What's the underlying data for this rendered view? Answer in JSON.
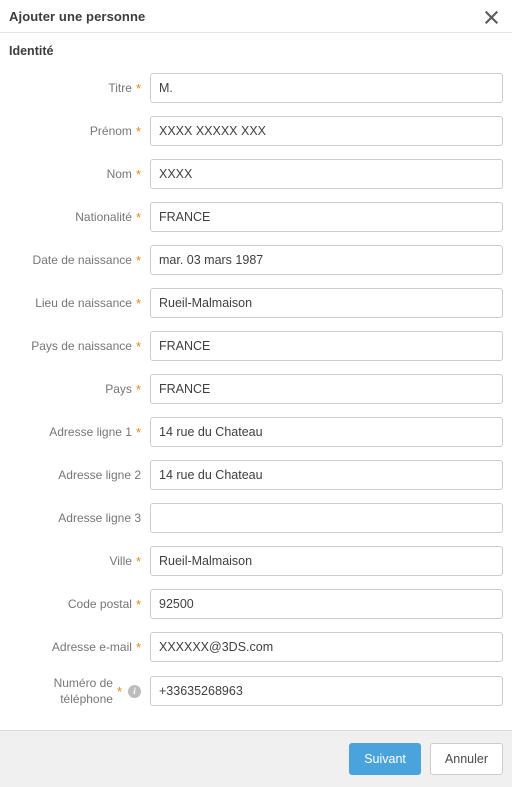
{
  "dialog": {
    "title": "Ajouter une personne",
    "close_icon": "close-icon",
    "section_title": "Identité"
  },
  "form": {
    "fields": [
      {
        "label": "Titre",
        "required": true,
        "value": "M.",
        "placeholder": "",
        "info": false
      },
      {
        "label": "Prénom",
        "required": true,
        "value": "XXXX XXXXX XXX",
        "placeholder": "",
        "info": false
      },
      {
        "label": "Nom",
        "required": true,
        "value": "XXXX",
        "placeholder": "",
        "info": false
      },
      {
        "label": "Nationalité",
        "required": true,
        "value": "FRANCE",
        "placeholder": "",
        "info": false
      },
      {
        "label": "Date de naissance",
        "required": true,
        "value": "mar. 03 mars 1987",
        "placeholder": "",
        "info": false
      },
      {
        "label": "Lieu de naissance",
        "required": true,
        "value": "Rueil-Malmaison",
        "placeholder": "",
        "info": false
      },
      {
        "label": "Pays de naissance",
        "required": true,
        "value": "FRANCE",
        "placeholder": "",
        "info": false
      },
      {
        "label": "Pays",
        "required": true,
        "value": "FRANCE",
        "placeholder": "",
        "info": false
      },
      {
        "label": "Adresse ligne 1",
        "required": true,
        "value": "14 rue du Chateau",
        "placeholder": "",
        "info": false
      },
      {
        "label": "Adresse ligne 2",
        "required": false,
        "value": "14 rue du Chateau",
        "placeholder": "",
        "info": false
      },
      {
        "label": "Adresse ligne 3",
        "required": false,
        "value": "",
        "placeholder": "",
        "info": false
      },
      {
        "label": "Ville",
        "required": true,
        "value": "Rueil-Malmaison",
        "placeholder": "",
        "info": false
      },
      {
        "label": "Code postal",
        "required": true,
        "value": "92500",
        "placeholder": "",
        "info": false
      },
      {
        "label": "Adresse e-mail",
        "required": true,
        "value": "XXXXXX@3DS.com",
        "placeholder": "",
        "info": false
      },
      {
        "label": "Numéro de\ntéléphone",
        "required": true,
        "value": "+33635268963",
        "placeholder": "",
        "info": true,
        "info_icon": "info-icon"
      }
    ],
    "required_marker": "*"
  },
  "footer": {
    "primary_label": "Suivant",
    "secondary_label": "Annuler"
  },
  "colors": {
    "primary": "#4aa3db",
    "required": "#e8890c",
    "label": "#767676",
    "border": "#cccccc",
    "footer_bg": "#f0f0f0"
  }
}
